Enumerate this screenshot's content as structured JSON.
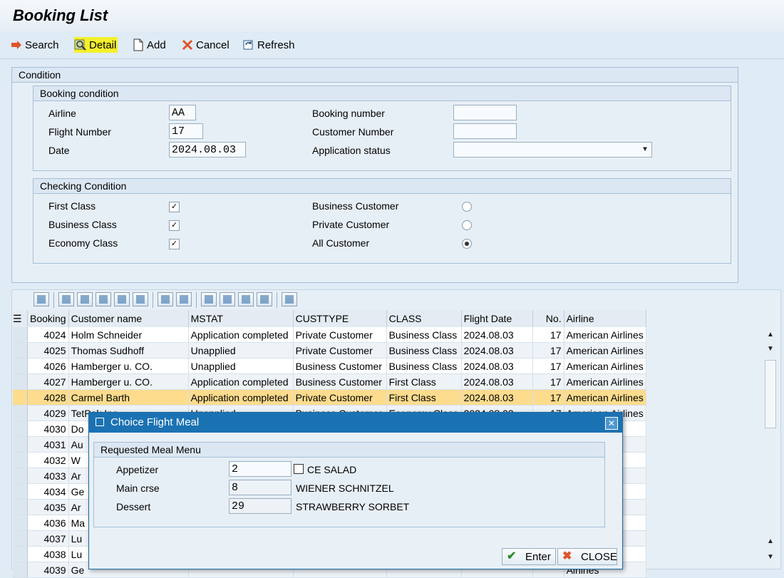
{
  "title": "Booking List",
  "toolbar": {
    "search": "Search",
    "detail": "Detail",
    "add": "Add",
    "cancel": "Cancel",
    "refresh": "Refresh"
  },
  "condition": {
    "title": "Condition",
    "booking": {
      "title": "Booking condition",
      "airline_label": "Airline",
      "airline_value": "AA",
      "flight_label": "Flight Number",
      "flight_value": "17",
      "date_label": "Date",
      "date_value": "2024.08.03",
      "booking_no_label": "Booking number",
      "booking_no_value": "",
      "customer_no_label": "Customer Number",
      "customer_no_value": "",
      "status_label": "Application status",
      "status_value": ""
    },
    "checking": {
      "title": "Checking Condition",
      "first_label": "First Class",
      "first_checked": true,
      "business_label": "Business Class",
      "business_checked": true,
      "economy_label": "Economy Class",
      "economy_checked": true,
      "bcust_label": "Business Customer",
      "pcust_label": "Private Customer",
      "allcust_label": "All Customer",
      "selected_customer": "All Customer"
    }
  },
  "grid": {
    "columns": [
      "Booking",
      "Customer name",
      "MSTAT",
      "CUSTTYPE",
      "CLASS",
      "Flight Date",
      "No.",
      "Airline"
    ],
    "rows": [
      [
        "4024",
        "Holm Schneider",
        "Application completed",
        "Private Customer",
        "Business Class",
        "2024.08.03",
        "17",
        "American Airlines"
      ],
      [
        "4025",
        "Thomas Sudhoff",
        "Unapplied",
        "Private Customer",
        "Business Class",
        "2024.08.03",
        "17",
        "American Airlines"
      ],
      [
        "4026",
        "Hamberger u. CO.",
        "Unapplied",
        "Business Customer",
        "Business Class",
        "2024.08.03",
        "17",
        "American Airlines"
      ],
      [
        "4027",
        "Hamberger u. CO.",
        "Application completed",
        "Business Customer",
        "First Class",
        "2024.08.03",
        "17",
        "American Airlines"
      ],
      [
        "4028",
        "Carmel Barth",
        "Application completed",
        "Private Customer",
        "First Class",
        "2024.08.03",
        "17",
        "American Airlines"
      ],
      [
        "4029",
        "TetPak Inc.",
        "Unapplied",
        "Business Customer",
        "Economy Class",
        "2024.08.03",
        "17",
        "American Airlines"
      ],
      [
        "4030",
        "Do",
        "",
        "",
        "",
        "",
        "",
        "Airlines"
      ],
      [
        "4031",
        "Au",
        "",
        "",
        "",
        "",
        "",
        "Airlines"
      ],
      [
        "4032",
        "W",
        "",
        "",
        "",
        "",
        "",
        "Airlines"
      ],
      [
        "4033",
        "Ar",
        "",
        "",
        "",
        "",
        "",
        "Airlines"
      ],
      [
        "4034",
        "Ge",
        "",
        "",
        "",
        "",
        "",
        "Airlines"
      ],
      [
        "4035",
        "Ar",
        "",
        "",
        "",
        "",
        "",
        "Airlines"
      ],
      [
        "4036",
        "Ma",
        "",
        "",
        "",
        "",
        "",
        "Airlines"
      ],
      [
        "4037",
        "Lu",
        "",
        "",
        "",
        "",
        "",
        "Airlines"
      ],
      [
        "4038",
        "Lu",
        "",
        "",
        "",
        "",
        "",
        "Airlines"
      ],
      [
        "4039",
        "Ge",
        "",
        "",
        "",
        "",
        "",
        "Airlines"
      ]
    ],
    "highlighted_booking": "4028"
  },
  "dialog": {
    "title": "Choice Flight Meal",
    "group_title": "Requested Meal Menu",
    "appetizer_label": "Appetizer",
    "appetizer_value": "2",
    "appetizer_text": "CE SALAD",
    "main_label": "Main crse",
    "main_value": "8",
    "main_text": "WIENER SCHNITZEL",
    "dessert_label": "Dessert",
    "dessert_value": "29",
    "dessert_text": "STRAWBERRY SORBET",
    "enter": "Enter",
    "close": "CLOSE"
  },
  "colors": {
    "dialog_title": "#1b72b3",
    "highlight_row": "#fddc8e",
    "detail_highlight": "#f4f02a"
  }
}
